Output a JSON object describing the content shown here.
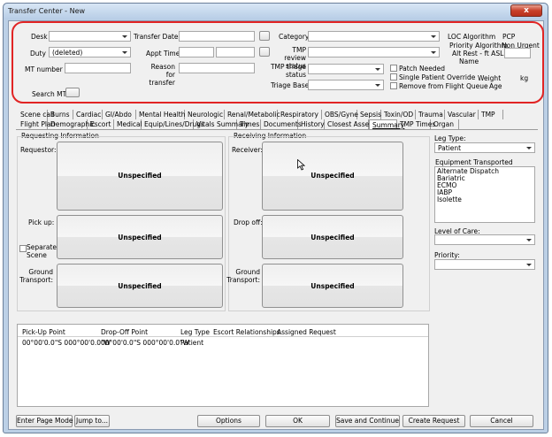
{
  "window": {
    "title": "Transfer Center - New",
    "close_label": "x"
  },
  "header": {
    "desk_label": "Desk",
    "duty_label": "Duty",
    "duty_value": "(deleted)",
    "mt_number_label": "MT number",
    "search_mt_label": "Search MT",
    "transfer_date_label": "Transfer Date",
    "appt_time_label": "Appt Time",
    "reason_label": "Reason for transfer",
    "category_label": "Category",
    "tmp_review_label": "TMP review status",
    "tmp_triage_label": "TMP triage status",
    "triage_base_label": "Triage Base",
    "patch_needed_label": "Patch Needed",
    "single_patient_label": "Single Patient Override",
    "remove_queue_label": "Remove from Flight Queue",
    "loc_algorithm_label": "LOC Algorithm",
    "loc_algorithm_value": "PCP",
    "priority_algorithm_label": "Priority Algorithm",
    "priority_algorithm_value": "Non Urgent",
    "alt_rest_label": "Alt Rest - ft ASL",
    "name_label": "Name",
    "weight_label": "Weight",
    "weight_unit": "kg",
    "age_label": "Age"
  },
  "tabs_row1": [
    "Scene call",
    "Burns",
    "Cardiac",
    "GI/Abdo",
    "Mental Health",
    "Neurologic",
    "Renal/Metabolic",
    "Respiratory",
    "OBS/Gyne",
    "Sepsis",
    "Toxin/OD",
    "Trauma",
    "Vascular",
    "TMP"
  ],
  "tabs_row2": [
    "Flight Plan",
    "Demographic",
    "Escort",
    "Medical",
    "Equip/Lines/Drugs",
    "Vitals Summary",
    "Times",
    "Documents",
    "History",
    "Closest Assets",
    "Summary",
    "TMP Times",
    "Organ"
  ],
  "requesting": {
    "title": "Requesting Information",
    "requestor_label": "Requestor:",
    "pickup_label": "Pick up:",
    "separate_scene_label": "Separate Scene",
    "ground_label": "Ground Transport:",
    "unspecified": "Unspecified"
  },
  "receiving": {
    "title": "Receiving Information",
    "receiver_label": "Receiver:",
    "dropoff_label": "Drop off:",
    "ground_label": "Ground Transport:",
    "unspecified": "Unspecified"
  },
  "right_panel": {
    "leg_type_label": "Leg Type:",
    "leg_type_value": "Patient",
    "equipment_label": "Equipment Transported",
    "equipment_items": [
      "Alternate Dispatch",
      "Bariatric",
      "ECMO",
      "IABP",
      "Isolette"
    ],
    "level_of_care_label": "Level of Care:",
    "priority_label": "Priority:"
  },
  "legs_table": {
    "headers": [
      "Pick-Up Point",
      "Drop-Off Point",
      "Leg Type",
      "Escort Relationships",
      "Assigned Request"
    ],
    "rows": [
      [
        "00°00'0.0\"S 000°00'0.0\"W",
        "00°00'0.0\"S 000°00'0.0\"W",
        "Patient",
        "",
        ""
      ]
    ]
  },
  "footer": {
    "enter_page_mode": "Enter Page Mode",
    "jump_to": "Jump to...",
    "options": "Options",
    "ok": "OK",
    "save_continue": "Save and Continue",
    "create_request": "Create Request",
    "cancel": "Cancel"
  }
}
